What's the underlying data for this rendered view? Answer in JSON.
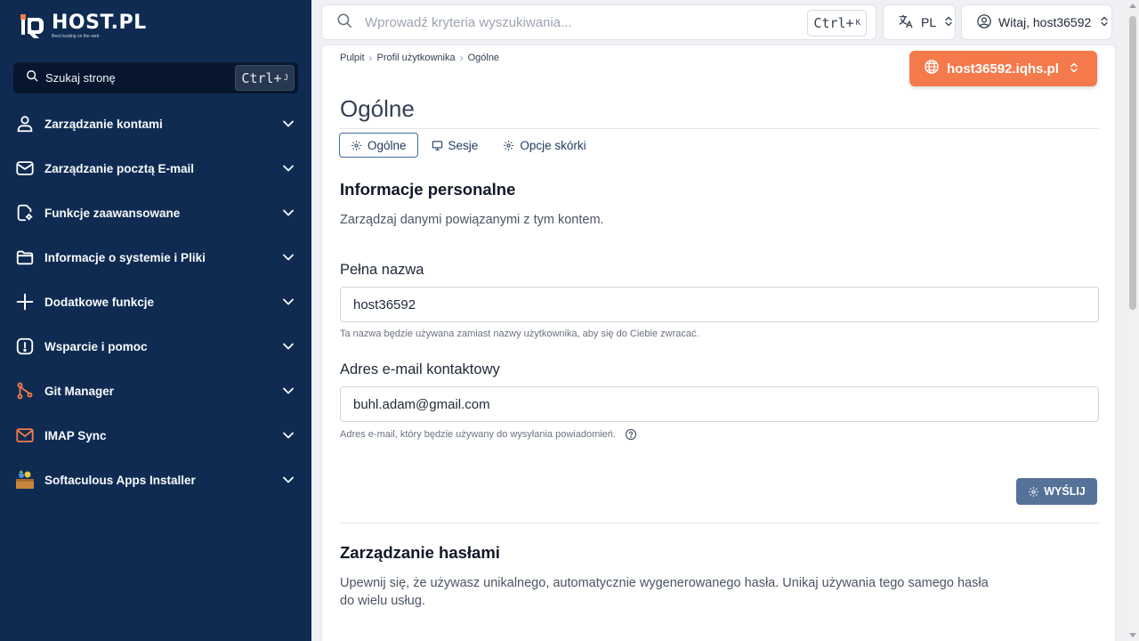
{
  "brand": {
    "name": "HOST.PL",
    "tagline": "Best hosting on the web",
    "accent": "#f47a4b",
    "sidebar_bg": "#0f2b52"
  },
  "sidebar": {
    "search_label": "Szukaj stronę",
    "search_shortcut": "Ctrl+",
    "search_shortcut_key": "J",
    "items": [
      {
        "label": "Zarządzanie kontami",
        "icon": "user-icon"
      },
      {
        "label": "Zarządzanie pocztą E-mail",
        "icon": "mail-icon"
      },
      {
        "label": "Funkcje zaawansowane",
        "icon": "file-settings-icon"
      },
      {
        "label": "Informacje o systemie i Pliki",
        "icon": "folder-icon"
      },
      {
        "label": "Dodatkowe funkcje",
        "icon": "plus-icon"
      },
      {
        "label": "Wsparcie i pomoc",
        "icon": "alert-icon"
      },
      {
        "label": "Git Manager",
        "icon": "git-icon"
      },
      {
        "label": "IMAP Sync",
        "icon": "imap-mail-icon"
      },
      {
        "label": "Softaculous Apps Installer",
        "icon": "softaculous-icon"
      }
    ]
  },
  "topbar": {
    "search_placeholder": "Wprowadź kryteria wyszukiwania...",
    "search_shortcut": "Ctrl+",
    "search_shortcut_key": "K",
    "language": "PL",
    "user_greeting": "Witaj, host36592"
  },
  "breadcrumb": [
    "Pulpit",
    "Profil użytkownika",
    "Ogólne"
  ],
  "domain": "host36592.iqhs.pl",
  "page_title": "Ogólne",
  "tabs": [
    {
      "label": "Ogólne",
      "active": true,
      "icon": "gear-icon"
    },
    {
      "label": "Sesje",
      "active": false,
      "icon": "monitor-icon"
    },
    {
      "label": "Opcje skórki",
      "active": false,
      "icon": "gear-icon"
    }
  ],
  "personal": {
    "heading": "Informacje personalne",
    "description": "Zarządzaj danymi powiązanymi z tym kontem.",
    "name_label": "Pełna nazwa",
    "name_value": "host36592",
    "name_hint": "Ta nazwa będzie używana zamiast nazwy użytkownika, aby się do Ciebie zwracać.",
    "email_label": "Adres e-mail kontaktowy",
    "email_value": "buhl.adam@gmail.com",
    "email_hint": "Adres e-mail, który będzie używany do wysyłania powiadomień.",
    "submit_label": "WYŚLIJ"
  },
  "passwords": {
    "heading": "Zarządzanie hasłami",
    "description_line1": "Upewnij się, że używasz unikalnego, automatycznie wygenerowanego hasła. Unikaj używania tego samego hasła",
    "description_line2": "do wielu usług."
  }
}
